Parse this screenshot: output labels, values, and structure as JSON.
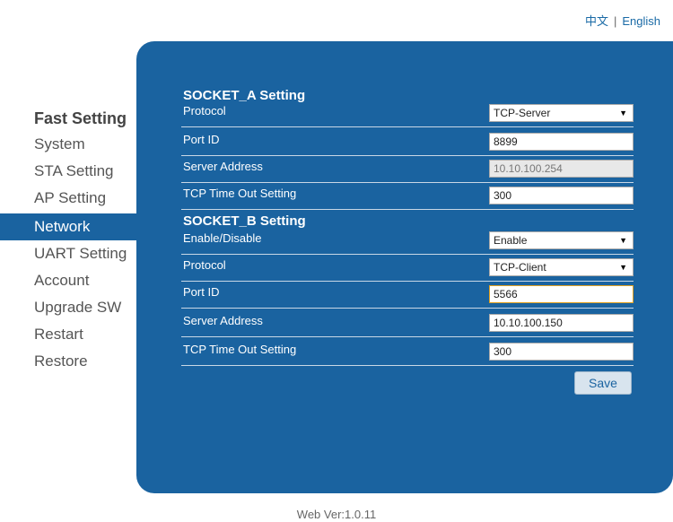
{
  "lang": {
    "chinese": "中文",
    "separator": "|",
    "english": "English"
  },
  "sidebar": {
    "title": "Fast Setting",
    "items": [
      {
        "label": "System"
      },
      {
        "label": "STA Setting"
      },
      {
        "label": "AP Setting"
      },
      {
        "label": "Network",
        "active": true
      },
      {
        "label": "UART Setting"
      },
      {
        "label": "Account"
      },
      {
        "label": "Upgrade SW"
      },
      {
        "label": "Restart"
      },
      {
        "label": "Restore"
      }
    ]
  },
  "socket_a": {
    "title": "SOCKET_A Setting",
    "protocol_label": "Protocol",
    "protocol_value": "TCP-Server",
    "port_label": "Port ID",
    "port_value": "8899",
    "server_label": "Server Address",
    "server_value": "10.10.100.254",
    "timeout_label": "TCP Time Out Setting",
    "timeout_value": "300"
  },
  "socket_b": {
    "title": "SOCKET_B Setting",
    "enable_label": "Enable/Disable",
    "enable_value": "Enable",
    "protocol_label": "Protocol",
    "protocol_value": "TCP-Client",
    "port_label": "Port ID",
    "port_value": "5566",
    "server_label": "Server Address",
    "server_value": "10.10.100.150",
    "timeout_label": "TCP Time Out Setting",
    "timeout_value": "300"
  },
  "save_label": "Save",
  "footer": "Web Ver:1.0.11",
  "colors": {
    "panel": "#1a63a0",
    "active_nav": "#1a63a0",
    "link": "#1a6aa6"
  }
}
